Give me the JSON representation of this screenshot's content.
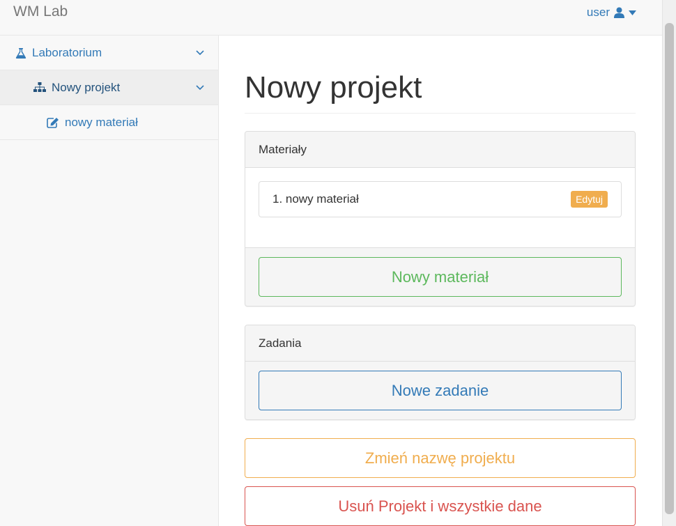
{
  "navbar": {
    "brand": "WM Lab",
    "user_label": "user",
    "user_icon": "user-icon",
    "caret_icon": "caret-down-icon"
  },
  "sidebar": {
    "items": [
      {
        "label": "Laboratorium",
        "icon": "flask-icon",
        "expandable": true
      },
      {
        "label": "Nowy projekt",
        "icon": "sitemap-icon",
        "expandable": true,
        "active": true
      },
      {
        "label": "nowy materiał",
        "icon": "edit-icon",
        "expandable": false
      }
    ]
  },
  "main": {
    "title": "Nowy projekt",
    "materials_panel": {
      "heading": "Materiały",
      "items": [
        {
          "label": "1. nowy materiał",
          "action": "Edytuj"
        }
      ],
      "add_button": "Nowy materiał"
    },
    "tasks_panel": {
      "heading": "Zadania",
      "add_button": "Nowe zadanie"
    },
    "rename_button": "Zmień nazwę projektu",
    "delete_button": "Usuń Projekt i wszystkie dane"
  },
  "colors": {
    "link": "#337ab7",
    "success": "#5cb85c",
    "warning": "#f0ad4e",
    "danger": "#d9534f"
  }
}
